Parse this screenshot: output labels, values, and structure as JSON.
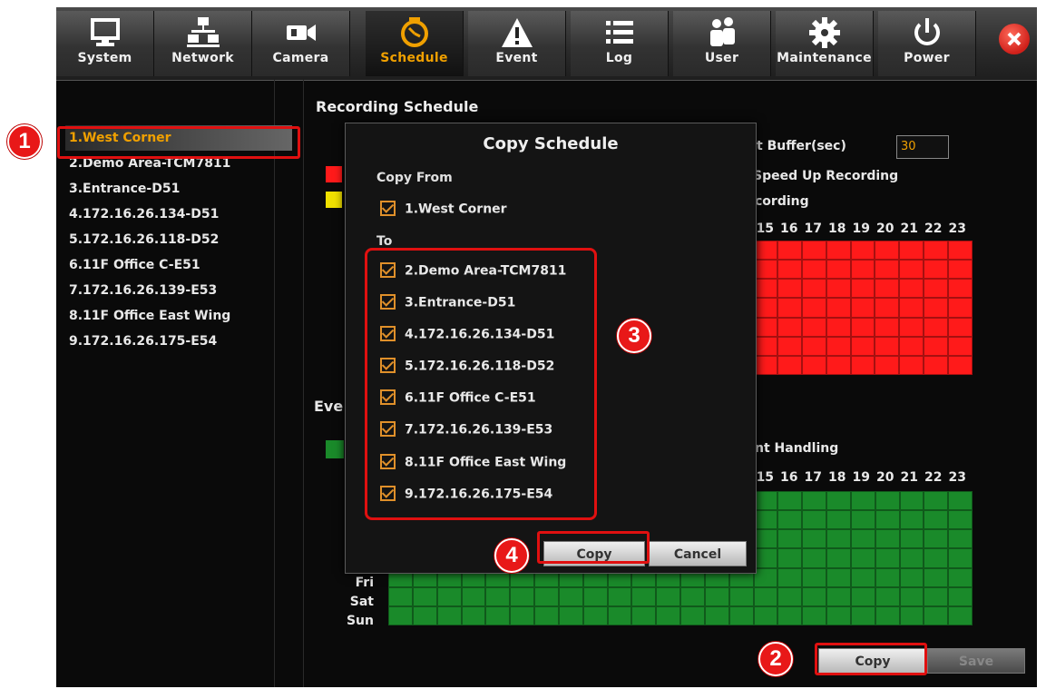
{
  "nav": {
    "tabs": [
      {
        "label": "System",
        "icon": "monitor-icon"
      },
      {
        "label": "Network",
        "icon": "network-icon"
      },
      {
        "label": "Camera",
        "icon": "camera-icon"
      },
      {
        "label": "Schedule",
        "icon": "clock-icon"
      },
      {
        "label": "Event",
        "icon": "warning-icon"
      },
      {
        "label": "Log",
        "icon": "list-icon"
      },
      {
        "label": "User",
        "icon": "users-icon"
      },
      {
        "label": "Maintenance",
        "icon": "gear-icon"
      },
      {
        "label": "Power",
        "icon": "power-icon"
      }
    ],
    "active_tab": "Schedule",
    "close_icon": "close-icon"
  },
  "camera_list": [
    "1.West Corner",
    "2.Demo Area-TCM7811",
    "3.Entrance-D51",
    "4.172.16.26.134-D51",
    "5.172.16.26.118-D52",
    "6.11F Office C-E51",
    "7.172.16.26.139-E53",
    "8.11F Office East Wing",
    "9.172.16.26.175-E54"
  ],
  "recording_schedule": {
    "title": "Recording Schedule",
    "buffer_label": "t Buffer(sec)",
    "buffer_value": "30",
    "speed_label": "Speed Up Recording",
    "recording_label": "cording",
    "hours": [
      "15",
      "16",
      "17",
      "18",
      "19",
      "20",
      "21",
      "22",
      "23"
    ],
    "grid_color": "#ff1a1a"
  },
  "event_schedule": {
    "title": "Eve",
    "handling_label": "nt Handling",
    "hours": [
      "15",
      "16",
      "17",
      "18",
      "19",
      "20",
      "21",
      "22",
      "23"
    ],
    "days": [
      "Fri",
      "Sat",
      "Sun"
    ],
    "grid_color": "#1a8a2a"
  },
  "footer": {
    "copy_label": "Copy",
    "save_label": "Save"
  },
  "dialog": {
    "title": "Copy Schedule",
    "copy_from_label": "Copy From",
    "copy_from_item": "1.West Corner",
    "to_label": "To",
    "to_items": [
      "2.Demo Area-TCM7811",
      "3.Entrance-D51",
      "4.172.16.26.134-D51",
      "5.172.16.26.118-D52",
      "6.11F Office C-E51",
      "7.172.16.26.139-E53",
      "8.11F Office East Wing",
      "9.172.16.26.175-E54"
    ],
    "copy_button": "Copy",
    "cancel_button": "Cancel"
  },
  "annotations": [
    "1",
    "2",
    "3",
    "4"
  ],
  "colors": {
    "accent": "#f0a000",
    "annotation": "#e01010"
  }
}
